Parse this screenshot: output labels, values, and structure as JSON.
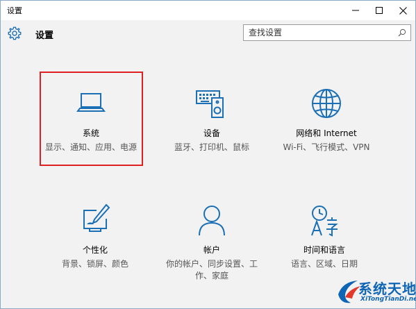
{
  "window": {
    "title": "设置",
    "controls": {
      "minimize": "minimize-icon",
      "maximize": "maximize-icon",
      "close": "close-icon"
    }
  },
  "header": {
    "title": "设置",
    "icon": "gear-icon"
  },
  "search": {
    "placeholder": "查找设置",
    "icon": "search-icon"
  },
  "accent": "#1a6fb5",
  "tiles": [
    {
      "name": "系统",
      "desc": "显示、通知、应用、电源",
      "icon": "laptop-icon"
    },
    {
      "name": "设备",
      "desc": "蓝牙、打印机、鼠标",
      "icon": "devices-icon"
    },
    {
      "name": "网络和 Internet",
      "desc": "Wi-Fi、飞行模式、VPN",
      "icon": "globe-icon"
    },
    {
      "name": "个性化",
      "desc": "背景、锁屏、颜色",
      "icon": "personalization-icon"
    },
    {
      "name": "帐户",
      "desc": "你的帐户、同步设置、工作、家庭",
      "icon": "person-icon"
    },
    {
      "name": "时间和语言",
      "desc": "语言、区域、日期",
      "icon": "time-language-icon"
    }
  ],
  "watermark": {
    "main": "系统天地",
    "sub": "XiTongTianDi.net"
  }
}
